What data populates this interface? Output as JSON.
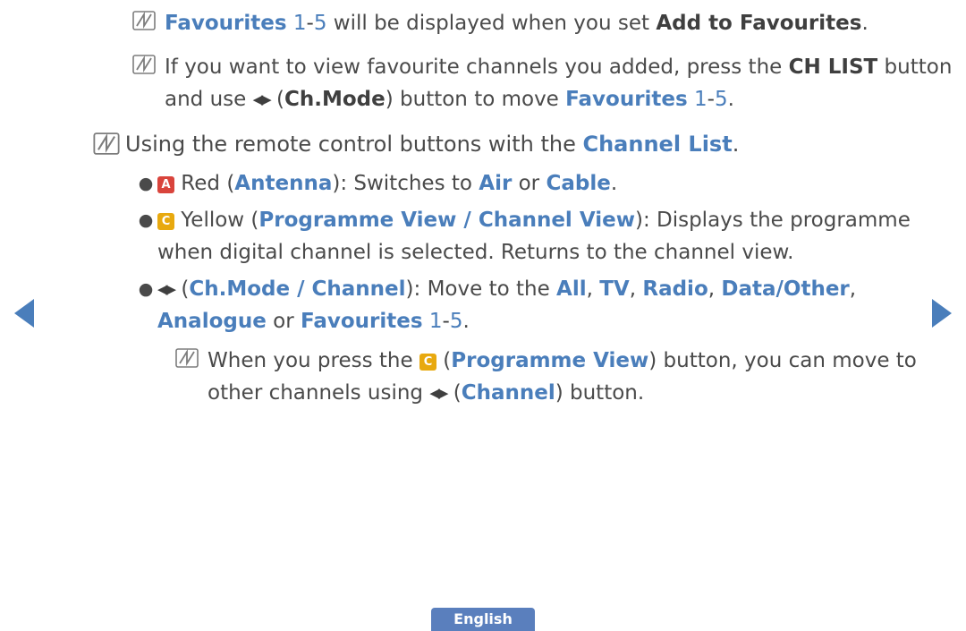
{
  "document": {
    "title": "Channel List remote control guide",
    "blocks": [
      {
        "id": "note1",
        "icon": "note-nn-icon",
        "segments": [
          {
            "t": "Favourites",
            "s": "blue"
          },
          {
            "t": " 1",
            "s": "blue-nb"
          },
          {
            "t": "-",
            "s": "plain"
          },
          {
            "t": "5",
            "s": "blue-nb"
          },
          {
            "t": " will be displayed when you set ",
            "s": "plain"
          },
          {
            "t": "Add to Favourites",
            "s": "bold"
          },
          {
            "t": ".",
            "s": "plain"
          }
        ]
      },
      {
        "id": "note2",
        "icon": "note-nn-icon",
        "segments": [
          {
            "t": "If you want to view favourite channels you added, press the ",
            "s": "plain"
          },
          {
            "t": "CH LIST",
            "s": "bold"
          },
          {
            "t": " button",
            "s": "plain"
          }
        ],
        "segments_line2": [
          {
            "t": "and use ",
            "s": "plain"
          },
          {
            "t": "arrows",
            "s": "arrows"
          },
          {
            "t": " (",
            "s": "plain"
          },
          {
            "t": "Ch.Mode",
            "s": "bold"
          },
          {
            "t": ") button to move ",
            "s": "plain"
          },
          {
            "t": "Favourites",
            "s": "blue"
          },
          {
            "t": " 1",
            "s": "blue-nb"
          },
          {
            "t": "-",
            "s": "plain"
          },
          {
            "t": "5",
            "s": "blue-nb"
          },
          {
            "t": ".",
            "s": "plain"
          }
        ]
      },
      {
        "id": "note3",
        "icon": "note-nn-icon",
        "segments": [
          {
            "t": "Using the remote control buttons with the ",
            "s": "plain"
          },
          {
            "t": "Channel List",
            "s": "blue"
          },
          {
            "t": ".",
            "s": "plain"
          }
        ]
      },
      {
        "id": "bullet1",
        "icon": "bullet-dot",
        "segments": [
          {
            "t": "A",
            "s": "key-red"
          },
          {
            "t": " Red (",
            "s": "plain"
          },
          {
            "t": "Antenna",
            "s": "blue"
          },
          {
            "t": "): Switches to ",
            "s": "plain"
          },
          {
            "t": "Air",
            "s": "blue"
          },
          {
            "t": " or ",
            "s": "plain"
          },
          {
            "t": "Cable",
            "s": "blue"
          },
          {
            "t": ".",
            "s": "plain"
          }
        ]
      },
      {
        "id": "bullet2",
        "icon": "bullet-dot",
        "segments": [
          {
            "t": "C",
            "s": "key-yellow"
          },
          {
            "t": " Yellow (",
            "s": "plain"
          },
          {
            "t": "Programme View / Channel View",
            "s": "blue"
          },
          {
            "t": "): Displays the programme",
            "s": "plain"
          }
        ],
        "segments_line2": [
          {
            "t": "when digital channel is selected. Returns to the channel view.",
            "s": "plain"
          }
        ]
      },
      {
        "id": "bullet3",
        "icon": "bullet-dot",
        "segments": [
          {
            "t": "arrows",
            "s": "arrows"
          },
          {
            "t": " (",
            "s": "plain"
          },
          {
            "t": "Ch.Mode / Channel",
            "s": "blue"
          },
          {
            "t": "): Move to the ",
            "s": "plain"
          },
          {
            "t": "All",
            "s": "blue"
          },
          {
            "t": ", ",
            "s": "plain"
          },
          {
            "t": "TV",
            "s": "blue"
          },
          {
            "t": ", ",
            "s": "plain"
          },
          {
            "t": "Radio",
            "s": "blue"
          },
          {
            "t": ", ",
            "s": "plain"
          },
          {
            "t": "Data/Other",
            "s": "blue"
          },
          {
            "t": ",",
            "s": "plain"
          }
        ],
        "segments_line2": [
          {
            "t": "Analogue",
            "s": "blue"
          },
          {
            "t": " or ",
            "s": "plain"
          },
          {
            "t": "Favourites",
            "s": "blue"
          },
          {
            "t": " 1",
            "s": "blue-nb"
          },
          {
            "t": "-",
            "s": "plain"
          },
          {
            "t": "5",
            "s": "blue-nb"
          },
          {
            "t": ".",
            "s": "plain"
          }
        ]
      },
      {
        "id": "subnote",
        "icon": "note-nn-icon",
        "segments": [
          {
            "t": "When you press the ",
            "s": "plain"
          },
          {
            "t": "C",
            "s": "key-yellow"
          },
          {
            "t": " (",
            "s": "plain"
          },
          {
            "t": "Programme View",
            "s": "blue"
          },
          {
            "t": ") button, you can move to",
            "s": "plain"
          }
        ],
        "segments_line2": [
          {
            "t": "other channels using ",
            "s": "plain"
          },
          {
            "t": "arrows",
            "s": "arrows"
          },
          {
            "t": " (",
            "s": "plain"
          },
          {
            "t": "Channel",
            "s": "blue"
          },
          {
            "t": ") button.",
            "s": "plain"
          }
        ]
      }
    ]
  },
  "navigation": {
    "prev_label": "previous page",
    "next_label": "next page"
  },
  "footer": {
    "language_label": "English"
  },
  "colors": {
    "accent_blue": "#4a7ebb",
    "key_red": "#d9443c",
    "key_yellow": "#e8a90f",
    "text": "#4a4a4a",
    "footer_button": "#5a7fbd"
  },
  "text": {
    "note1_l1_a": "Favourites",
    "note1_l1_b": " 1",
    "note1_l1_c": "-",
    "note1_l1_d": "5",
    "note1_l1_e": " will be displayed when you set ",
    "note1_l1_f": "Add to Favourites",
    "note1_l1_g": ".",
    "note2_l1_a": "If you want to view favourite channels you added, press the ",
    "note2_l1_b": "CH LIST",
    "note2_l1_c": " button",
    "note2_l2_a": "and use ",
    "note2_l2_b": " (",
    "note2_l2_c": "Ch.Mode",
    "note2_l2_d": ") button to move ",
    "note2_l2_e": "Favourites",
    "note2_l2_f": " 1",
    "note2_l2_g": "-",
    "note2_l2_h": "5",
    "note2_l2_i": ".",
    "note3_a": "Using the remote control buttons with the ",
    "note3_b": "Channel List",
    "note3_c": ".",
    "b1_key": "A",
    "b1_a": " Red (",
    "b1_b": "Antenna",
    "b1_c": "): Switches to ",
    "b1_d": "Air",
    "b1_e": " or ",
    "b1_f": "Cable",
    "b1_g": ".",
    "b2_key": "C",
    "b2_a": " Yellow (",
    "b2_b": "Programme View / Channel View",
    "b2_c": "): Displays the programme",
    "b2_l2": "when digital channel is selected. Returns to the channel view.",
    "b3_a": " (",
    "b3_b": "Ch.Mode / Channel",
    "b3_c": "): Move to the ",
    "b3_d": "All",
    "b3_e": ", ",
    "b3_f": "TV",
    "b3_g": ", ",
    "b3_h": "Radio",
    "b3_i": ", ",
    "b3_j": "Data/Other",
    "b3_k": ",",
    "b3_l2_a": "Analogue",
    "b3_l2_b": " or ",
    "b3_l2_c": "Favourites",
    "b3_l2_d": " 1",
    "b3_l2_e": "-",
    "b3_l2_f": "5",
    "b3_l2_g": ".",
    "sub_a": "When you press the ",
    "sub_key": "C",
    "sub_b": " (",
    "sub_c": "Programme View",
    "sub_d": ") button, you can move to",
    "sub_l2_a": "other channels using ",
    "sub_l2_b": " (",
    "sub_l2_c": "Channel",
    "sub_l2_d": ") button."
  }
}
